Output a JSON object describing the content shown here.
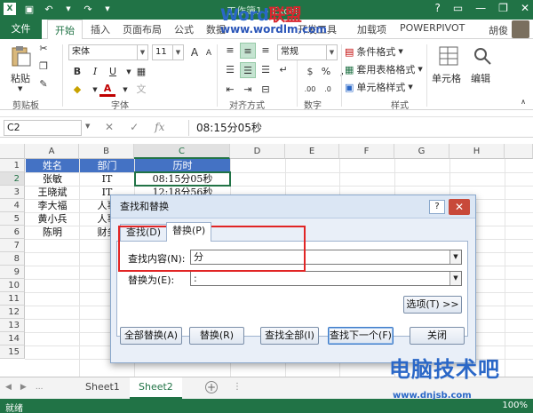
{
  "window": {
    "title": "工作簿1 - Excel",
    "minimize": "—",
    "restore": "❐",
    "close": "✕"
  },
  "watermark": {
    "logo_word": "Word",
    "logo_cn": "联盟",
    "url": "www.wordlm.com",
    "bottom_text": "电脑技术吧",
    "bottom_url": "www.dnjsb.com"
  },
  "ribbon_tabs": [
    {
      "label": "文件"
    },
    {
      "label": "开始"
    },
    {
      "label": "插入"
    },
    {
      "label": "页面布局"
    },
    {
      "label": "公式"
    },
    {
      "label": "数据"
    },
    {
      "label": "审阅"
    },
    {
      "label": "视图"
    },
    {
      "label": "开发工具"
    },
    {
      "label": "加载项"
    },
    {
      "label": "POWERPIVOT"
    }
  ],
  "user": {
    "name": "胡俊"
  },
  "ribbon": {
    "paste_label": "粘贴",
    "clipboard_label": "剪贴板",
    "font_name": "宋体",
    "font_size": "11",
    "font_group_label": "字体",
    "align_group_label": "对齐方式",
    "number_format": "常规",
    "number_group_label": "数字",
    "cond_format": "条件格式",
    "table_format": "套用表格格式",
    "cell_style": "单元格样式",
    "styles_group_label": "样式",
    "cells_label": "单元格",
    "editing_label": "编辑",
    "bold": "B",
    "italic": "I",
    "underline": "U",
    "font_color_glyph": "A",
    "grow_font": "A",
    "shrink_font": "A",
    "percent": "%",
    "comma": ",",
    "inc_dec": ".00",
    "dec_dec": ".0"
  },
  "formula_bar": {
    "name_box": "C2",
    "cancel": "✕",
    "enter": "✓",
    "fx": "fx",
    "content": "08:15分05秒"
  },
  "grid": {
    "columns": [
      "A",
      "B",
      "C",
      "D",
      "E",
      "F",
      "G",
      "H"
    ],
    "rows": [
      "1",
      "2",
      "3",
      "4",
      "5",
      "6",
      "7",
      "8",
      "9",
      "10",
      "11",
      "12",
      "13",
      "14",
      "15"
    ],
    "headers": [
      "姓名",
      "部门",
      "历时"
    ],
    "data": [
      [
        "张敏",
        "IT",
        "08:15分05秒"
      ],
      [
        "王晓斌",
        "IT",
        "12:18分56秒"
      ],
      [
        "李大福",
        "人事",
        ""
      ],
      [
        "黄小兵",
        "人事",
        ""
      ],
      [
        "陈明",
        "财务",
        ""
      ]
    ]
  },
  "sheets": {
    "tabs": [
      "Sheet1",
      "Sheet2"
    ],
    "active": "Sheet2",
    "add": "+",
    "nav_prev": "◀",
    "nav_next": "▶",
    "nav_more": "..."
  },
  "status": {
    "ready": "就绪",
    "zoom": "100%"
  },
  "dialog": {
    "title": "查找和替换",
    "help": "?",
    "close": "✕",
    "tab_find": "查找(D)",
    "tab_replace": "替换(P)",
    "find_label": "查找内容(N):",
    "find_value": "分",
    "replace_label": "替换为(E):",
    "replace_value": ":",
    "options_btn": "选项(T) >>",
    "btn_replace_all": "全部替换(A)",
    "btn_replace": "替换(R)",
    "btn_find_all": "查找全部(I)",
    "btn_find_next": "查找下一个(F)",
    "btn_close": "关闭"
  },
  "colors": {
    "excel_green": "#217346",
    "header_fill": "#4472c4",
    "highlight_red": "#e12525"
  }
}
